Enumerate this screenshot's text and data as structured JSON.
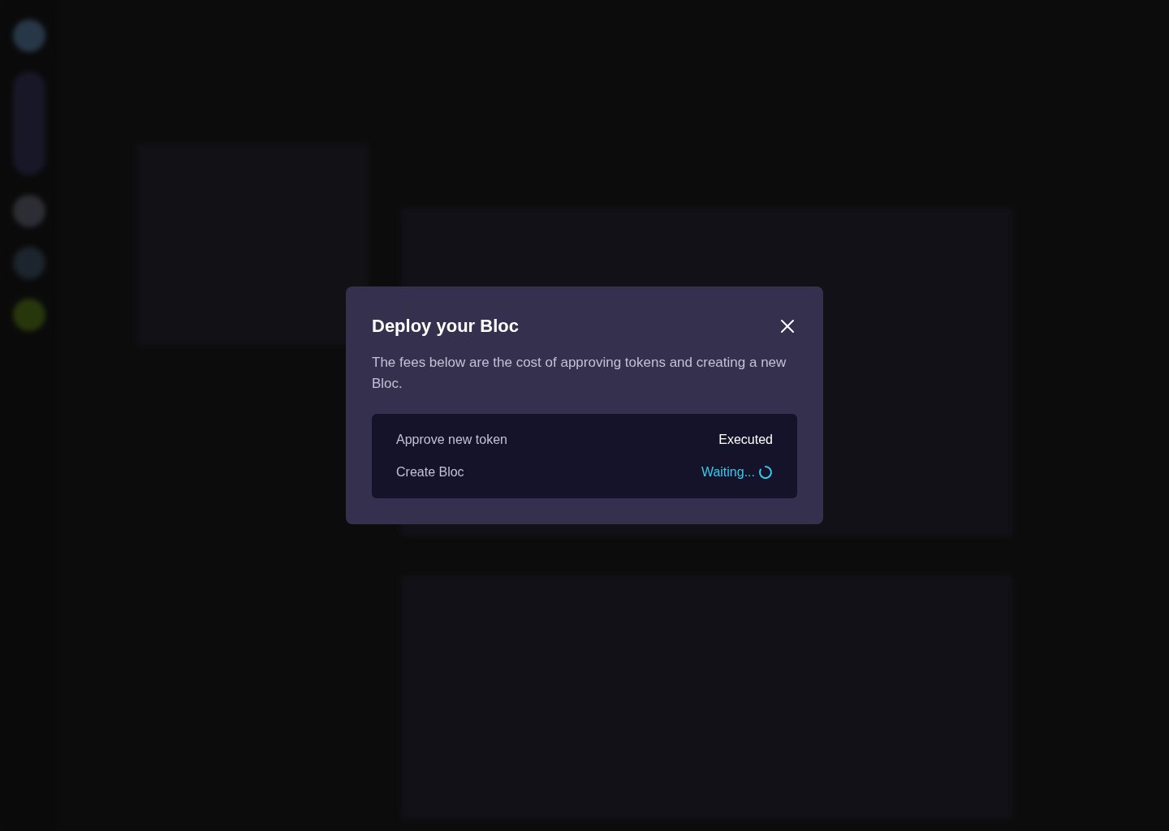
{
  "dialog": {
    "title": "Deploy your Bloc",
    "description": "The fees below are the cost of approving tokens and creating a new Bloc.",
    "steps": [
      {
        "label": "Approve new token",
        "status": "Executed",
        "kind": "done"
      },
      {
        "label": "Create Bloc",
        "status": "Waiting...",
        "kind": "pending"
      }
    ]
  }
}
